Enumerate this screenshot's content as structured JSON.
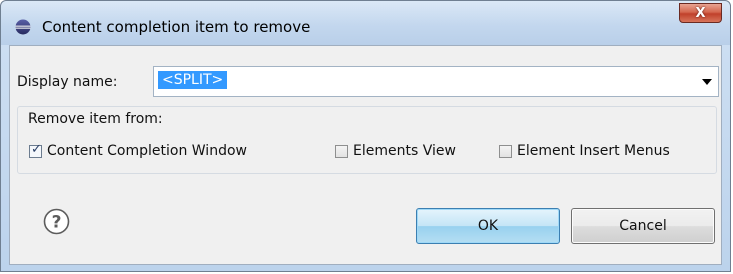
{
  "window": {
    "title": "Content completion item to remove",
    "close_label": "X"
  },
  "display_name": {
    "label": "Display name:",
    "value": "<SPLIT>"
  },
  "remove_group": {
    "label": "Remove item from:",
    "options": [
      {
        "label": "Content Completion Window",
        "checked": true
      },
      {
        "label": "Elements View",
        "checked": false
      },
      {
        "label": "Element Insert Menus",
        "checked": false
      }
    ]
  },
  "buttons": {
    "ok_label": "OK",
    "cancel_label": "Cancel"
  },
  "icons": {
    "app": "eclipse-icon",
    "help": "help-icon",
    "dropdown": "chevron-down-icon"
  },
  "colors": {
    "selection": "#3399ff",
    "close_button": "#c0412b",
    "ok_button_border": "#3c7fb1"
  }
}
